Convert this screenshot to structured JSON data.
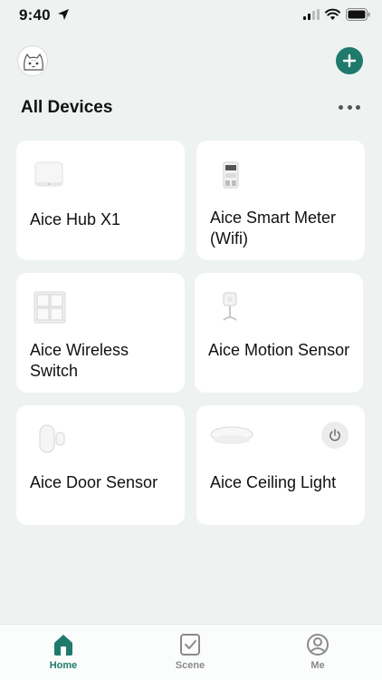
{
  "status_bar": {
    "time": "9:40"
  },
  "header": {
    "title": "All Devices",
    "avatar_icon": "cat-avatar-icon",
    "add_icon": "plus-icon",
    "more_icon": "more-horizontal-icon"
  },
  "devices": [
    {
      "name": "Aice Hub X1",
      "icon": "hub-icon"
    },
    {
      "name": "Aice Smart Meter (Wifi)",
      "icon": "smart-meter-icon"
    },
    {
      "name": "Aice Wireless Switch",
      "icon": "wireless-switch-icon"
    },
    {
      "name": "Aice Motion Sensor",
      "icon": "motion-sensor-icon"
    },
    {
      "name": "Aice Door Sensor",
      "icon": "door-sensor-icon"
    },
    {
      "name": "Aice Ceiling Light",
      "icon": "ceiling-light-icon",
      "power_icon": "power-icon"
    }
  ],
  "tabbar": {
    "tabs": [
      {
        "label": "Home",
        "icon": "home-icon",
        "active": true
      },
      {
        "label": "Scene",
        "icon": "scene-check-icon",
        "active": false
      },
      {
        "label": "Me",
        "icon": "profile-icon",
        "active": false
      }
    ]
  },
  "colors": {
    "accent": "#1f7a6c",
    "background": "#eef3f2",
    "card": "#ffffff"
  }
}
